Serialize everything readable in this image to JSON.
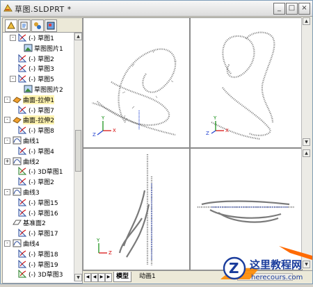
{
  "window": {
    "title": "草图.SLDPRT *",
    "minimize": "_",
    "maximize": "□",
    "close": "×"
  },
  "tree": {
    "expander_plus": "+",
    "expander_minus": "-",
    "rows": [
      {
        "text": "(-) 草图1"
      },
      {
        "text": "草图图片1"
      },
      {
        "text": "(-) 草图2"
      },
      {
        "text": "(-) 草图3"
      },
      {
        "text": "(-) 草图5"
      },
      {
        "text": "草图图片2"
      },
      {
        "text": "曲面-拉伸1"
      },
      {
        "text": "(-) 草图7"
      },
      {
        "text": "曲面-拉伸2"
      },
      {
        "text": "(-) 草图8"
      },
      {
        "text": "曲线1"
      },
      {
        "text": "(-) 草图4"
      },
      {
        "text": "曲线2"
      },
      {
        "text": "(-) 3D草图1"
      },
      {
        "text": "(-) 草图2"
      },
      {
        "text": "曲线3"
      },
      {
        "text": "(-) 草图15"
      },
      {
        "text": "(-) 草图16"
      },
      {
        "text": "基准面2"
      },
      {
        "text": "(-) 草图17"
      },
      {
        "text": "曲线4"
      },
      {
        "text": "(-) 草图18"
      },
      {
        "text": "(-) 草图19"
      },
      {
        "text": "(-) 3D草图3"
      }
    ]
  },
  "tabs": {
    "model": "模型",
    "motion": "动画1"
  },
  "axis": {
    "x": "X",
    "y": "Y",
    "z": "Z"
  },
  "watermark": {
    "title": "这里教程网",
    "url": "herecours.com",
    "logo_letter": "Z"
  },
  "colors": {
    "axis_x": "#d40000",
    "axis_y": "#0a8a0a",
    "axis_z": "#2040d0",
    "curve": "#7a7a7a",
    "accent": "#1a3c9c"
  }
}
